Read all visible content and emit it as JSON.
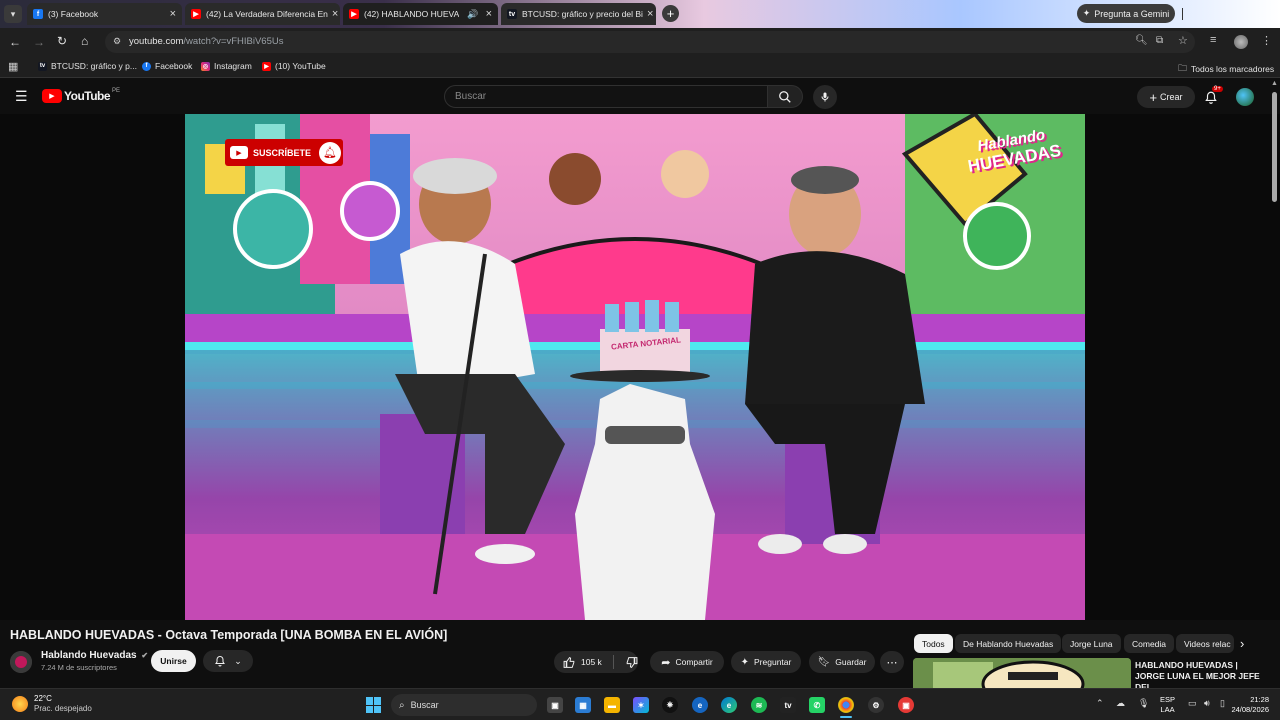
{
  "browser": {
    "tabs": [
      {
        "title": "(3) Facebook",
        "favicon": "facebook-icon",
        "active": false
      },
      {
        "title": "(42) La Verdadera Diferencia En",
        "favicon": "youtube-icon",
        "active": false
      },
      {
        "title": "(42) HABLANDO HUEVADA",
        "favicon": "youtube-icon",
        "active": true
      },
      {
        "title": "BTCUSD: gráfico y precio del Bi",
        "favicon": "tradingview-icon",
        "active": false
      }
    ],
    "gemini_label": "Pregunta a Gemini",
    "url_host": "youtube.com",
    "url_path": "/watch?v=vFHIBiV65Us",
    "bookmarks": [
      {
        "label": "BTCUSD: gráfico y p...",
        "icon": "tradingview-icon"
      },
      {
        "label": "Facebook",
        "icon": "facebook-icon"
      },
      {
        "label": "Instagram",
        "icon": "instagram-icon"
      },
      {
        "label": "(10) YouTube",
        "icon": "youtube-icon"
      }
    ],
    "all_bookmarks_label": "Todos los marcadores"
  },
  "youtube": {
    "logo_text": "YouTube",
    "region": "PE",
    "search_placeholder": "Buscar",
    "create_label": "Crear",
    "notifications_badge": "9+"
  },
  "video": {
    "subscribe_overlay": "SUSCRÍBETE",
    "show_logo_line1": "Hablando",
    "show_logo_line2": "HUEVADAS",
    "sign_text": "CARTA NOTARIAL"
  },
  "meta": {
    "title": "HABLANDO HUEVADAS - Octava Temporada [UNA BOMBA EN EL AVIÓN]",
    "channel_name": "Hablando Huevadas",
    "subscribers": "7.24 M de suscriptores",
    "join_label": "Unirse",
    "likes": "105 k",
    "share_label": "Compartir",
    "ask_label": "Preguntar",
    "save_label": "Guardar"
  },
  "chips": [
    "Todos",
    "De Hablando Huevadas",
    "Jorge Luna",
    "Comedia",
    "Videos relac"
  ],
  "recommendation": {
    "title": "HABLANDO HUEVADAS | JORGE LUNA EL MEJOR JEFE DEL"
  },
  "taskbar": {
    "weather_temp": "22°C",
    "weather_desc": "Prac. despejado",
    "search_label": "Buscar",
    "lang1": "ESP",
    "lang2": "LAA",
    "time": "21:28",
    "date": "24/08/2026"
  },
  "colors": {
    "youtube_red": "#ff0000",
    "background": "#0f0f0f",
    "chip_bg": "#272727"
  }
}
